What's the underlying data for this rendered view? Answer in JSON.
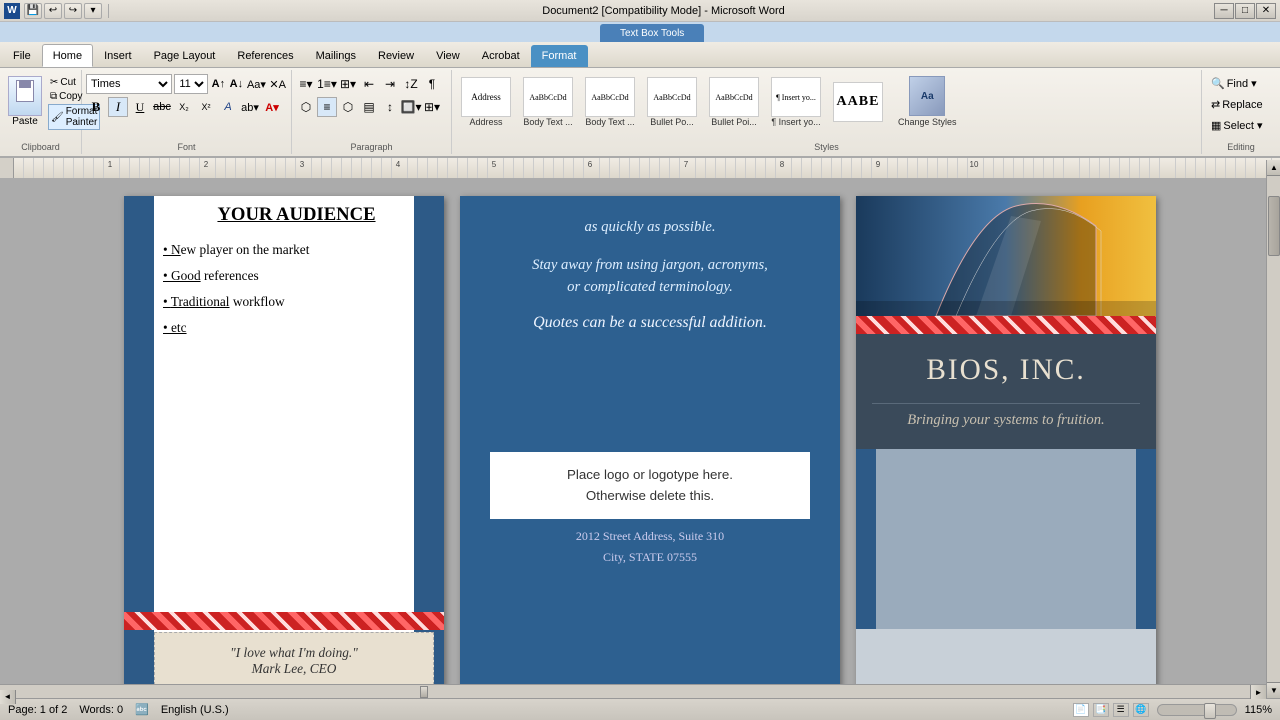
{
  "titlebar": {
    "title": "Document2 [Compatibility Mode] - Microsoft Word",
    "min_label": "─",
    "max_label": "□",
    "close_label": "✕"
  },
  "context_tab": {
    "label": "Text Box Tools",
    "sub_tab": "Format"
  },
  "ribbon_tabs": {
    "file": "File",
    "home": "Home",
    "insert": "Insert",
    "page_layout": "Page Layout",
    "references": "References",
    "mailings": "Mailings",
    "review": "Review",
    "view": "View",
    "acrobat": "Acrobat",
    "format": "Format"
  },
  "clipboard": {
    "paste_label": "Paste",
    "cut_label": "Cut",
    "copy_label": "Copy",
    "format_painter_label": "Format Painter",
    "group_label": "Clipboard"
  },
  "font": {
    "family": "Times",
    "size": "11",
    "group_label": "Font"
  },
  "paragraph": {
    "group_label": "Paragraph"
  },
  "styles": {
    "group_label": "Styles",
    "items": [
      {
        "label": "Address",
        "preview": "Address"
      },
      {
        "label": "Body Text ...",
        "preview": "Body Text"
      },
      {
        "label": "Body Text ...",
        "preview": "Body Text"
      },
      {
        "label": "Bullet Po...",
        "preview": "• Bullet"
      },
      {
        "label": "Bullet Poi...",
        "preview": "• Bullet"
      },
      {
        "label": "¶ Insert yo...",
        "preview": "¶ Insert"
      },
      {
        "label": "AABE",
        "preview": "AABE"
      }
    ],
    "change_styles_label": "Change\nStyles",
    "select_label": "Select ▾"
  },
  "editing": {
    "group_label": "Editing",
    "find_label": "Find ▾",
    "replace_label": "Replace",
    "select_label": "Select ▾"
  },
  "left_page": {
    "title": "YOUR AUDIENCE",
    "bullets": [
      "• New player on the market",
      "• Good references",
      "• Traditional workflow",
      "• etc"
    ],
    "quote": "\"I love what I'm doing.\"\nMark Lee, CEO"
  },
  "middle_page": {
    "text1": "as quickly as possible.",
    "text2": "Stay away from using jargon, acronyms,\nor complicated terminology.",
    "text3": "Quotes can be a successful addition.",
    "logo_text1": "Place logo  or logotype here.",
    "logo_text2": "Otherwise delete this.",
    "address1": "2012 Street Address,  Suite 310",
    "address2": "City, STATE 07555"
  },
  "right_page": {
    "company_name": "BIOS, INC.",
    "tagline": "Bringing your systems to fruition."
  },
  "statusbar": {
    "page_info": "Page: 1 of 2",
    "words": "Words: 0",
    "language": "English (U.S.)",
    "zoom": "115%"
  },
  "scrollbar": {
    "h_thumb_label": ""
  }
}
